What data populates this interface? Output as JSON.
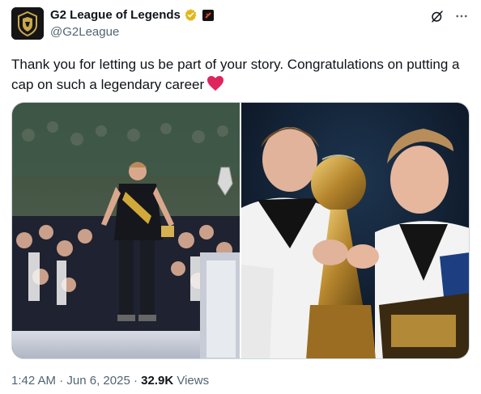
{
  "account": {
    "display_name": "G2 League of Legends",
    "handle": "@G2League"
  },
  "tweet": {
    "text": "Thank you for letting us be part of your story. Congratulations on putting a cap on such a legendary career"
  },
  "meta": {
    "time": "1:42 AM",
    "date": "Jun 6, 2025",
    "separator": "·",
    "views_count": "32.9K",
    "views_label": "Views"
  },
  "icons": {
    "verified": "gold-verified-badge-icon",
    "affiliate": "affiliate-badge-icon",
    "grok": "grok-icon",
    "more": "more-icon",
    "heart": "red-heart-icon"
  },
  "colors": {
    "text": "#0f1419",
    "muted": "#536471",
    "verified_gold": "#e2b719",
    "heart_red": "#e0245e",
    "border": "#cfd9de"
  }
}
